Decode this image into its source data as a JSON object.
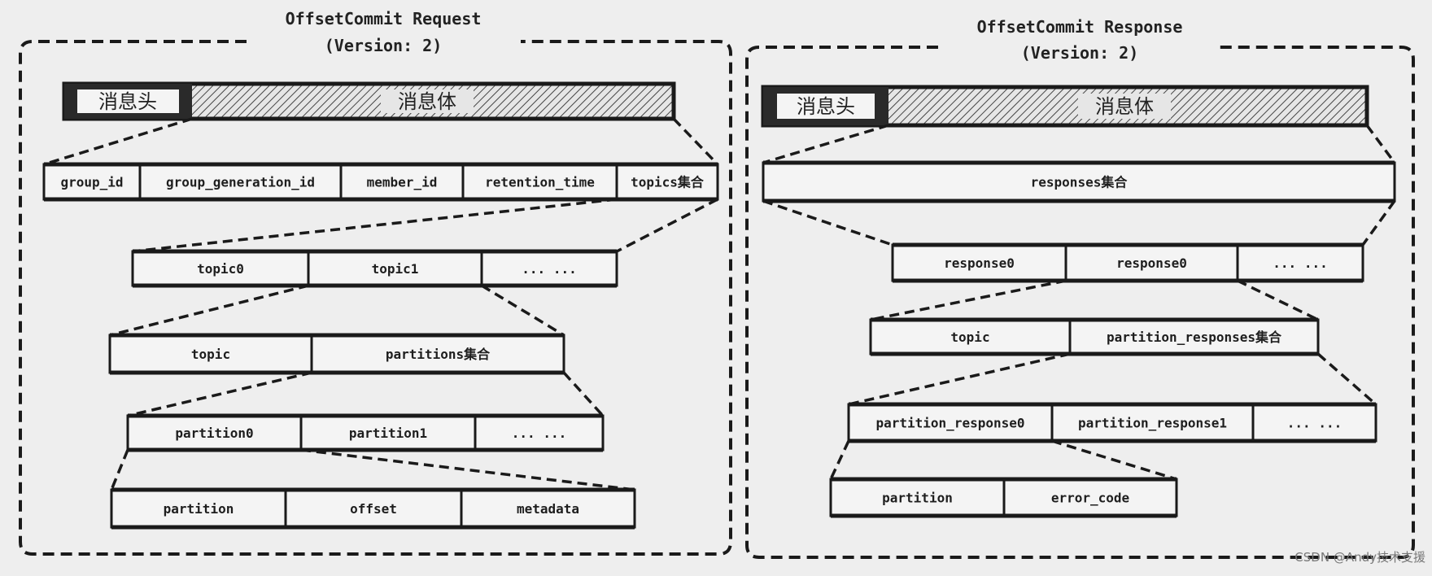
{
  "request": {
    "title": "OffsetCommit Request",
    "version": "(Version: 2)",
    "header": {
      "head_label": "消息头",
      "body_label": "消息体"
    },
    "rows": [
      {
        "name": "request-fields",
        "cells": [
          "group_id",
          "group_generation_id",
          "member_id",
          "retention_time",
          "topics集合"
        ]
      },
      {
        "name": "topics-list",
        "cells": [
          "topic0",
          "topic1",
          "... ..."
        ]
      },
      {
        "name": "topic-struct",
        "cells": [
          "topic",
          "partitions集合"
        ]
      },
      {
        "name": "partitions-list",
        "cells": [
          "partition0",
          "partition1",
          "... ..."
        ]
      },
      {
        "name": "partition-struct",
        "cells": [
          "partition",
          "offset",
          "metadata"
        ]
      }
    ]
  },
  "response": {
    "title": "OffsetCommit Response",
    "version": "(Version: 2)",
    "header": {
      "head_label": "消息头",
      "body_label": "消息体"
    },
    "rows": [
      {
        "name": "response-fields",
        "cells": [
          "responses集合"
        ]
      },
      {
        "name": "responses-list",
        "cells": [
          "response0",
          "response0",
          "... ..."
        ]
      },
      {
        "name": "response-struct",
        "cells": [
          "topic",
          "partition_responses集合"
        ]
      },
      {
        "name": "partition-responses-list",
        "cells": [
          "partition_response0",
          "partition_response1",
          "... ..."
        ]
      },
      {
        "name": "partition-response-struct",
        "cells": [
          "partition",
          "error_code"
        ]
      }
    ]
  },
  "watermark": "CSDN @Andy技术支援"
}
